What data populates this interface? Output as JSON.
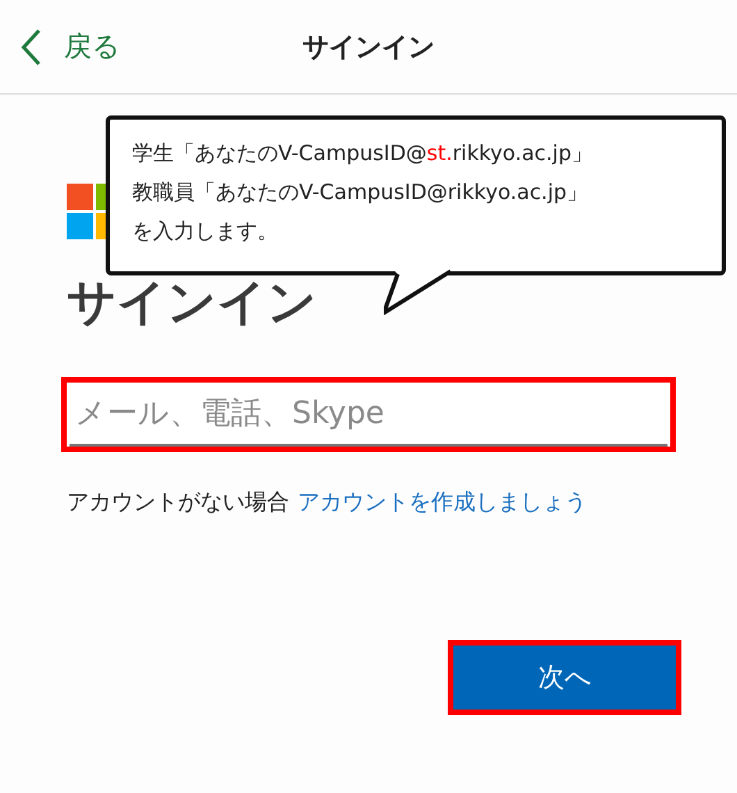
{
  "header": {
    "back_label": "戻る",
    "title": "サインイン"
  },
  "callout": {
    "lines": [
      {
        "parts": [
          {
            "text": "学生「あなたのV-CampusID@",
            "emphasis": false
          },
          {
            "text": "st.",
            "emphasis": true
          },
          {
            "text": "rikkyo.ac.jp」",
            "emphasis": false
          }
        ]
      },
      {
        "parts": [
          {
            "text": "教職員「あなたのV-CampusID@rikkyo.ac.jp」",
            "emphasis": false
          }
        ]
      },
      {
        "parts": [
          {
            "text": "を入力します。",
            "emphasis": false
          }
        ]
      }
    ]
  },
  "heading": "サインイン",
  "email_field": {
    "placeholder": "メール、電話、Skype",
    "highlighted": true
  },
  "no_account": {
    "text": "アカウントがない場合",
    "link": "アカウントを作成しましょう"
  },
  "next_button": {
    "label": "次へ",
    "highlighted": true
  }
}
